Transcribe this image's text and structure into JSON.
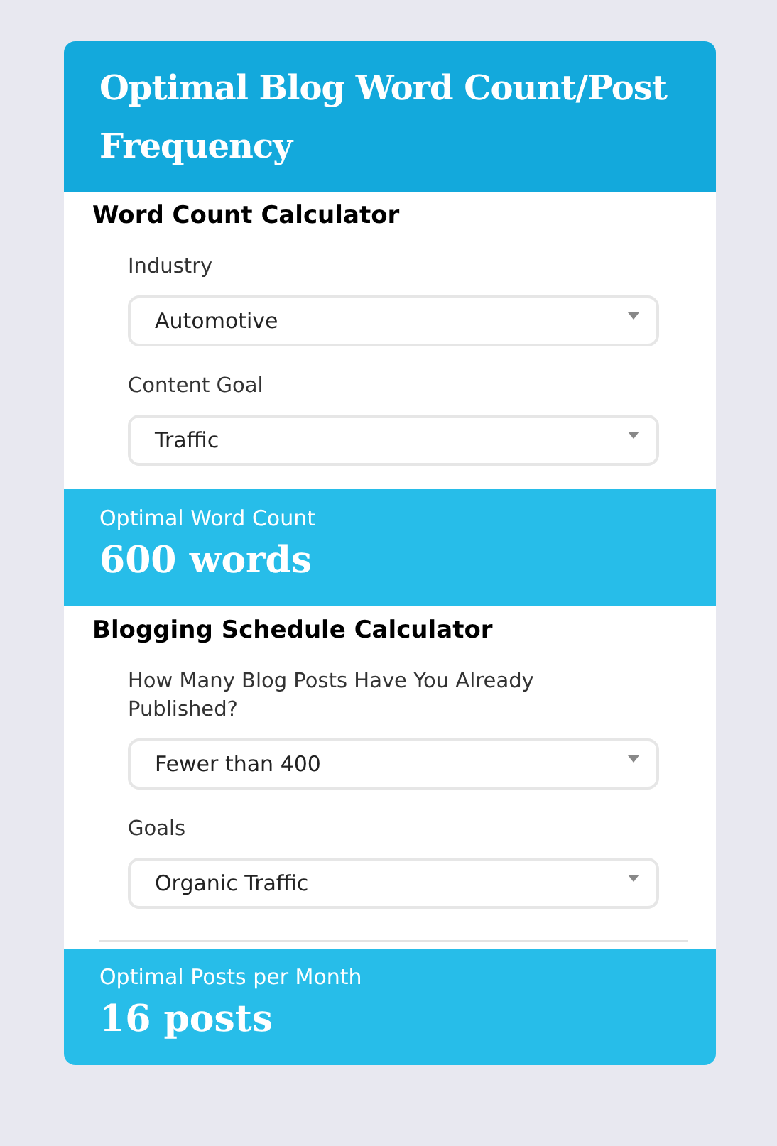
{
  "title": "Optimal Blog Word Count/Post Frequency",
  "sections": [
    {
      "heading": "Word Count Calculator",
      "fields": [
        {
          "label": "Industry",
          "value": "Automotive"
        },
        {
          "label": "Content Goal",
          "value": "Traffic"
        }
      ],
      "divider": false,
      "result": {
        "label": "Optimal Word Count",
        "value": "600 words"
      }
    },
    {
      "heading": "Blogging Schedule Calculator",
      "fields": [
        {
          "label": "How Many Blog Posts Have You Already Published?",
          "value": "Fewer than 400"
        },
        {
          "label": "Goals",
          "value": "Organic Traffic"
        }
      ],
      "divider": true,
      "result": {
        "label": "Optimal Posts per Month",
        "value": "16 posts"
      }
    }
  ]
}
